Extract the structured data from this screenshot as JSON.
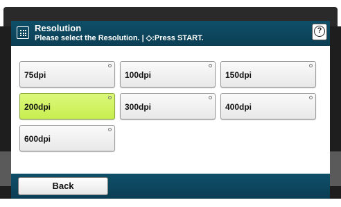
{
  "header": {
    "title": "Resolution",
    "subtitle": "Please select the Resolution. | ◇:Press START.",
    "help_label": "?"
  },
  "options": [
    {
      "label": "75dpi",
      "selected": false
    },
    {
      "label": "100dpi",
      "selected": false
    },
    {
      "label": "150dpi",
      "selected": false
    },
    {
      "label": "200dpi",
      "selected": true
    },
    {
      "label": "300dpi",
      "selected": false
    },
    {
      "label": "400dpi",
      "selected": false
    },
    {
      "label": "600dpi",
      "selected": false
    }
  ],
  "footer": {
    "back_label": "Back"
  },
  "colors": {
    "header_bg": "#0f4f68",
    "selected_bg": "#c7ee50"
  }
}
